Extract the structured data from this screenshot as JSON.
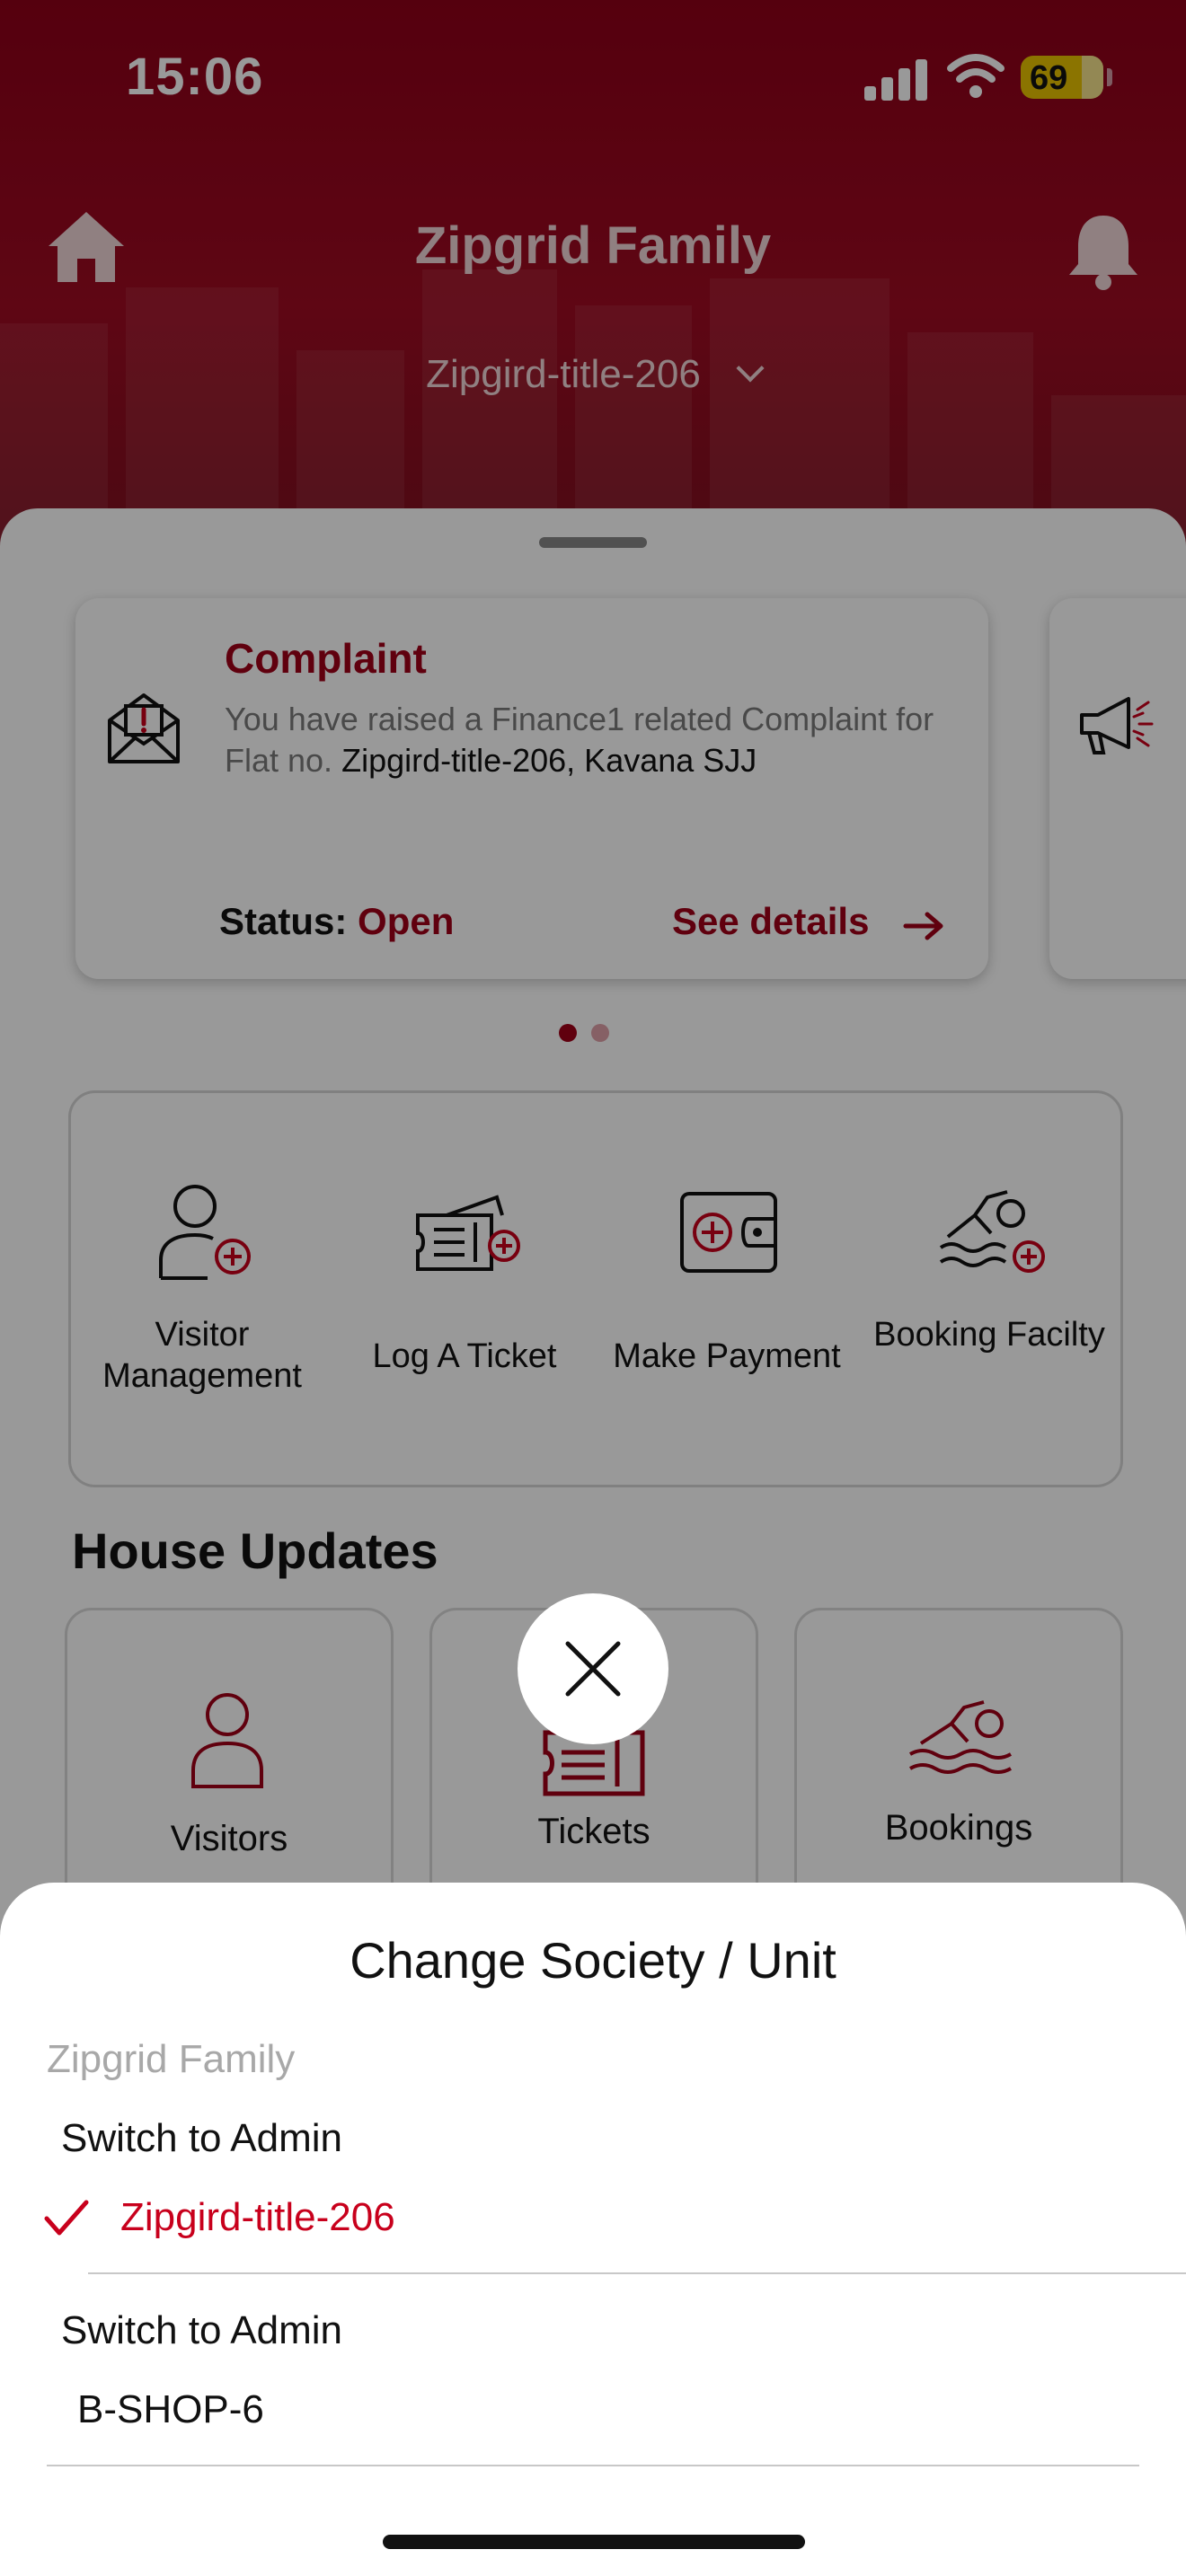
{
  "status_bar": {
    "time": "15:06",
    "battery": "69"
  },
  "header": {
    "title": "Zipgrid Family",
    "unit": "Zipgird-title-206"
  },
  "complaint_card": {
    "title": "Complaint",
    "text_prefix": "You have raised a Finance1 related Complaint for Flat no.",
    "text_highlight": "Zipgird-title-206, Kavana SJJ",
    "status_label": "Status:",
    "status_value": "Open",
    "details_link": "See details"
  },
  "quick_actions": [
    {
      "label": "Visitor Management",
      "icon": "visitor-add-icon"
    },
    {
      "label": "Log A Ticket",
      "icon": "ticket-add-icon"
    },
    {
      "label": "Make Payment",
      "icon": "wallet-add-icon"
    },
    {
      "label": "Booking Facilty",
      "icon": "swimmer-add-icon"
    }
  ],
  "house_updates": {
    "title": "House Updates",
    "cards": [
      {
        "label": "Visitors",
        "icon": "person-icon"
      },
      {
        "label": "Tickets",
        "icon": "ticket-icon"
      },
      {
        "label": "Bookings",
        "icon": "swimmer-icon"
      }
    ]
  },
  "sheet": {
    "title": "Change Society / Unit",
    "group": "Zipgrid Family",
    "options": [
      {
        "role": "Switch to Admin",
        "unit": "Zipgird-title-206",
        "selected": true
      },
      {
        "role": "Switch to Admin",
        "unit": "B-SHOP-6",
        "selected": false
      }
    ]
  },
  "colors": {
    "brand": "#8e0018",
    "accent_red": "#a00018",
    "selected_red": "#c8001c"
  }
}
